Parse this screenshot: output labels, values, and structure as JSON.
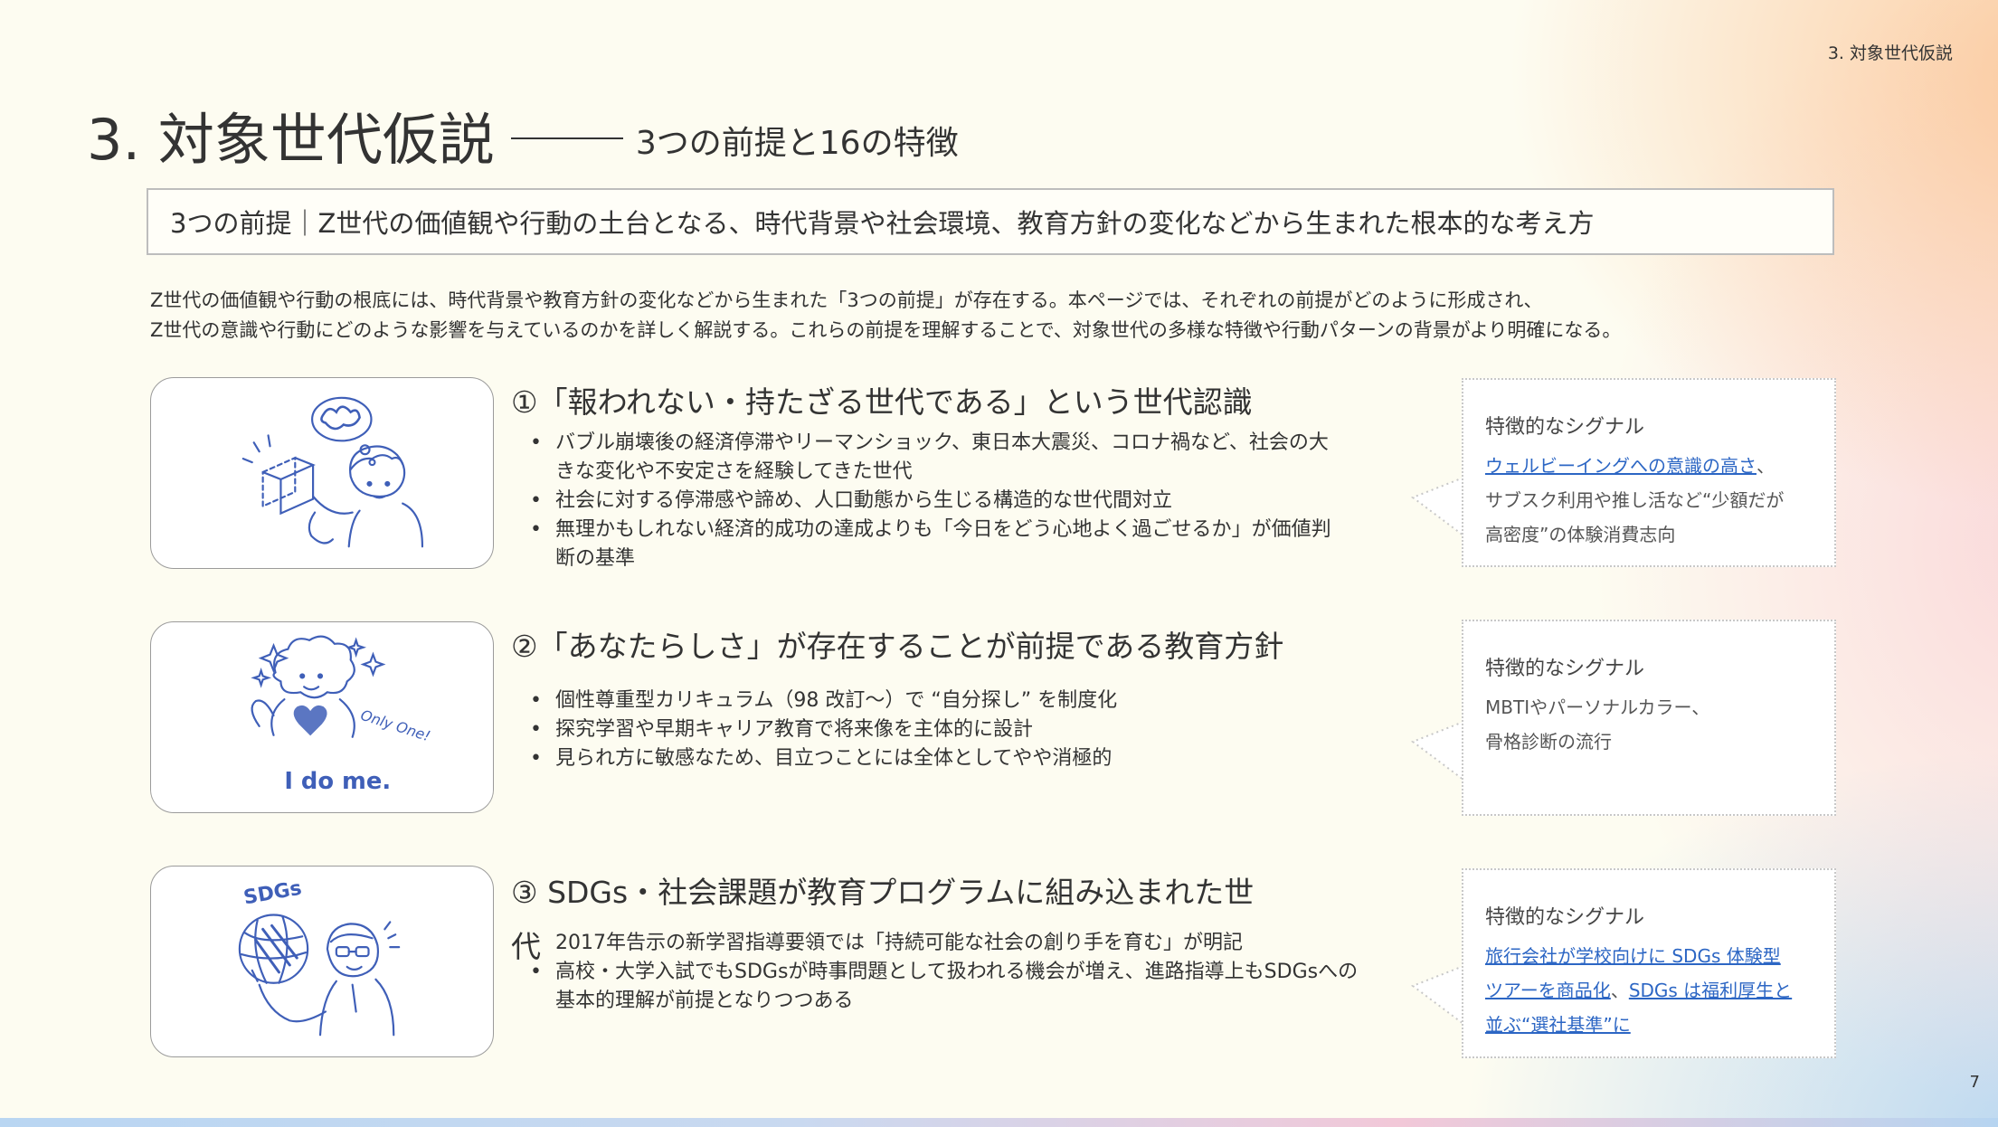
{
  "header": {
    "section_label": "3.  対象世代仮説",
    "page_number": "7"
  },
  "title": {
    "main": "3. 対象世代仮説",
    "sub": "3つの前提と16の特徴"
  },
  "premise_box": "3つの前提｜Z世代の価値観や行動の土台となる、時代背景や社会環境、教育方針の変化などから生まれた根本的な考え方",
  "intro": [
    "Z世代の価値観や行動の根底には、時代背景や教育方針の変化などから生まれた「3つの前提」が存在する。本ページでは、それぞれの前提がどのように形成され、",
    "Z世代の意識や行動にどのような影響を与えているのかを詳しく解説する。これらの前提を理解することで、対象世代の多様な特徴や行動パターンの背景がより明確になる。"
  ],
  "sections": [
    {
      "title": "①「報われない・持たざる世代である」という世代認識",
      "bullets": [
        "バブル崩壊後の経済停滞やリーマンショック、東日本大震災、コロナ禍など、社会の大",
        "きな変化や不安定さを経験してきた世代",
        " 社会に対する停滞感や諦め、人口動態から生じる構造的な世代間対立",
        "無理かもしれない経済的成功の達成よりも「今日をどう心地よく過ごせるか」が価値判",
        "断の基準"
      ],
      "signal": {
        "heading": "特徴的なシグナル",
        "link1": "ウェルビーイングへの意識の高さ",
        "text1": "、",
        "text2": "サブスク利用や推し活など“少額だが",
        "text3": "高密度”の体験消費志向"
      }
    },
    {
      "title": "②「あなたらしさ」が存在することが前提である教育方針",
      "bullets": [
        " 個性尊重型カリキュラム（98 改訂～）で “自分探し” を制度化",
        " 探究学習や早期キャリア教育で将来像を主体的に設計",
        "見られ方に敏感なため、目立つことには全体としてやや消極的"
      ],
      "illustration_text": {
        "only_one": "Only One!",
        "i_do_me": "I do me."
      },
      "signal": {
        "heading": "特徴的なシグナル",
        "text1": "MBTIやパーソナルカラー、",
        "text2": "骨格診断の流行"
      }
    },
    {
      "title_line1": "③ SDGs・社会課題が教育プログラムに組み込まれた世",
      "title_line2": "代",
      "bullets": [
        "2017年告示の新学習指導要領では「持続可能な社会の創り手を育む」が明記",
        "高校・大学入試でもSDGsが時事問題として扱われる機会が増え、進路指導上もSDGsへの",
        "基本的理解が前提となりつつある"
      ],
      "illustration_text": {
        "sdgs": "SDGs"
      },
      "signal": {
        "heading": "特徴的なシグナル",
        "link1": "旅行会社が学校向けに SDGs 体験型",
        "link2": "ツアーを商品化",
        "text1": "、",
        "link3": "SDGs は福利厚生と",
        "link4": "並ぶ“選社基準”に"
      }
    }
  ],
  "colors": {
    "accent_link": "#2c66c4",
    "illustration_stroke": "#3f5fb8"
  }
}
